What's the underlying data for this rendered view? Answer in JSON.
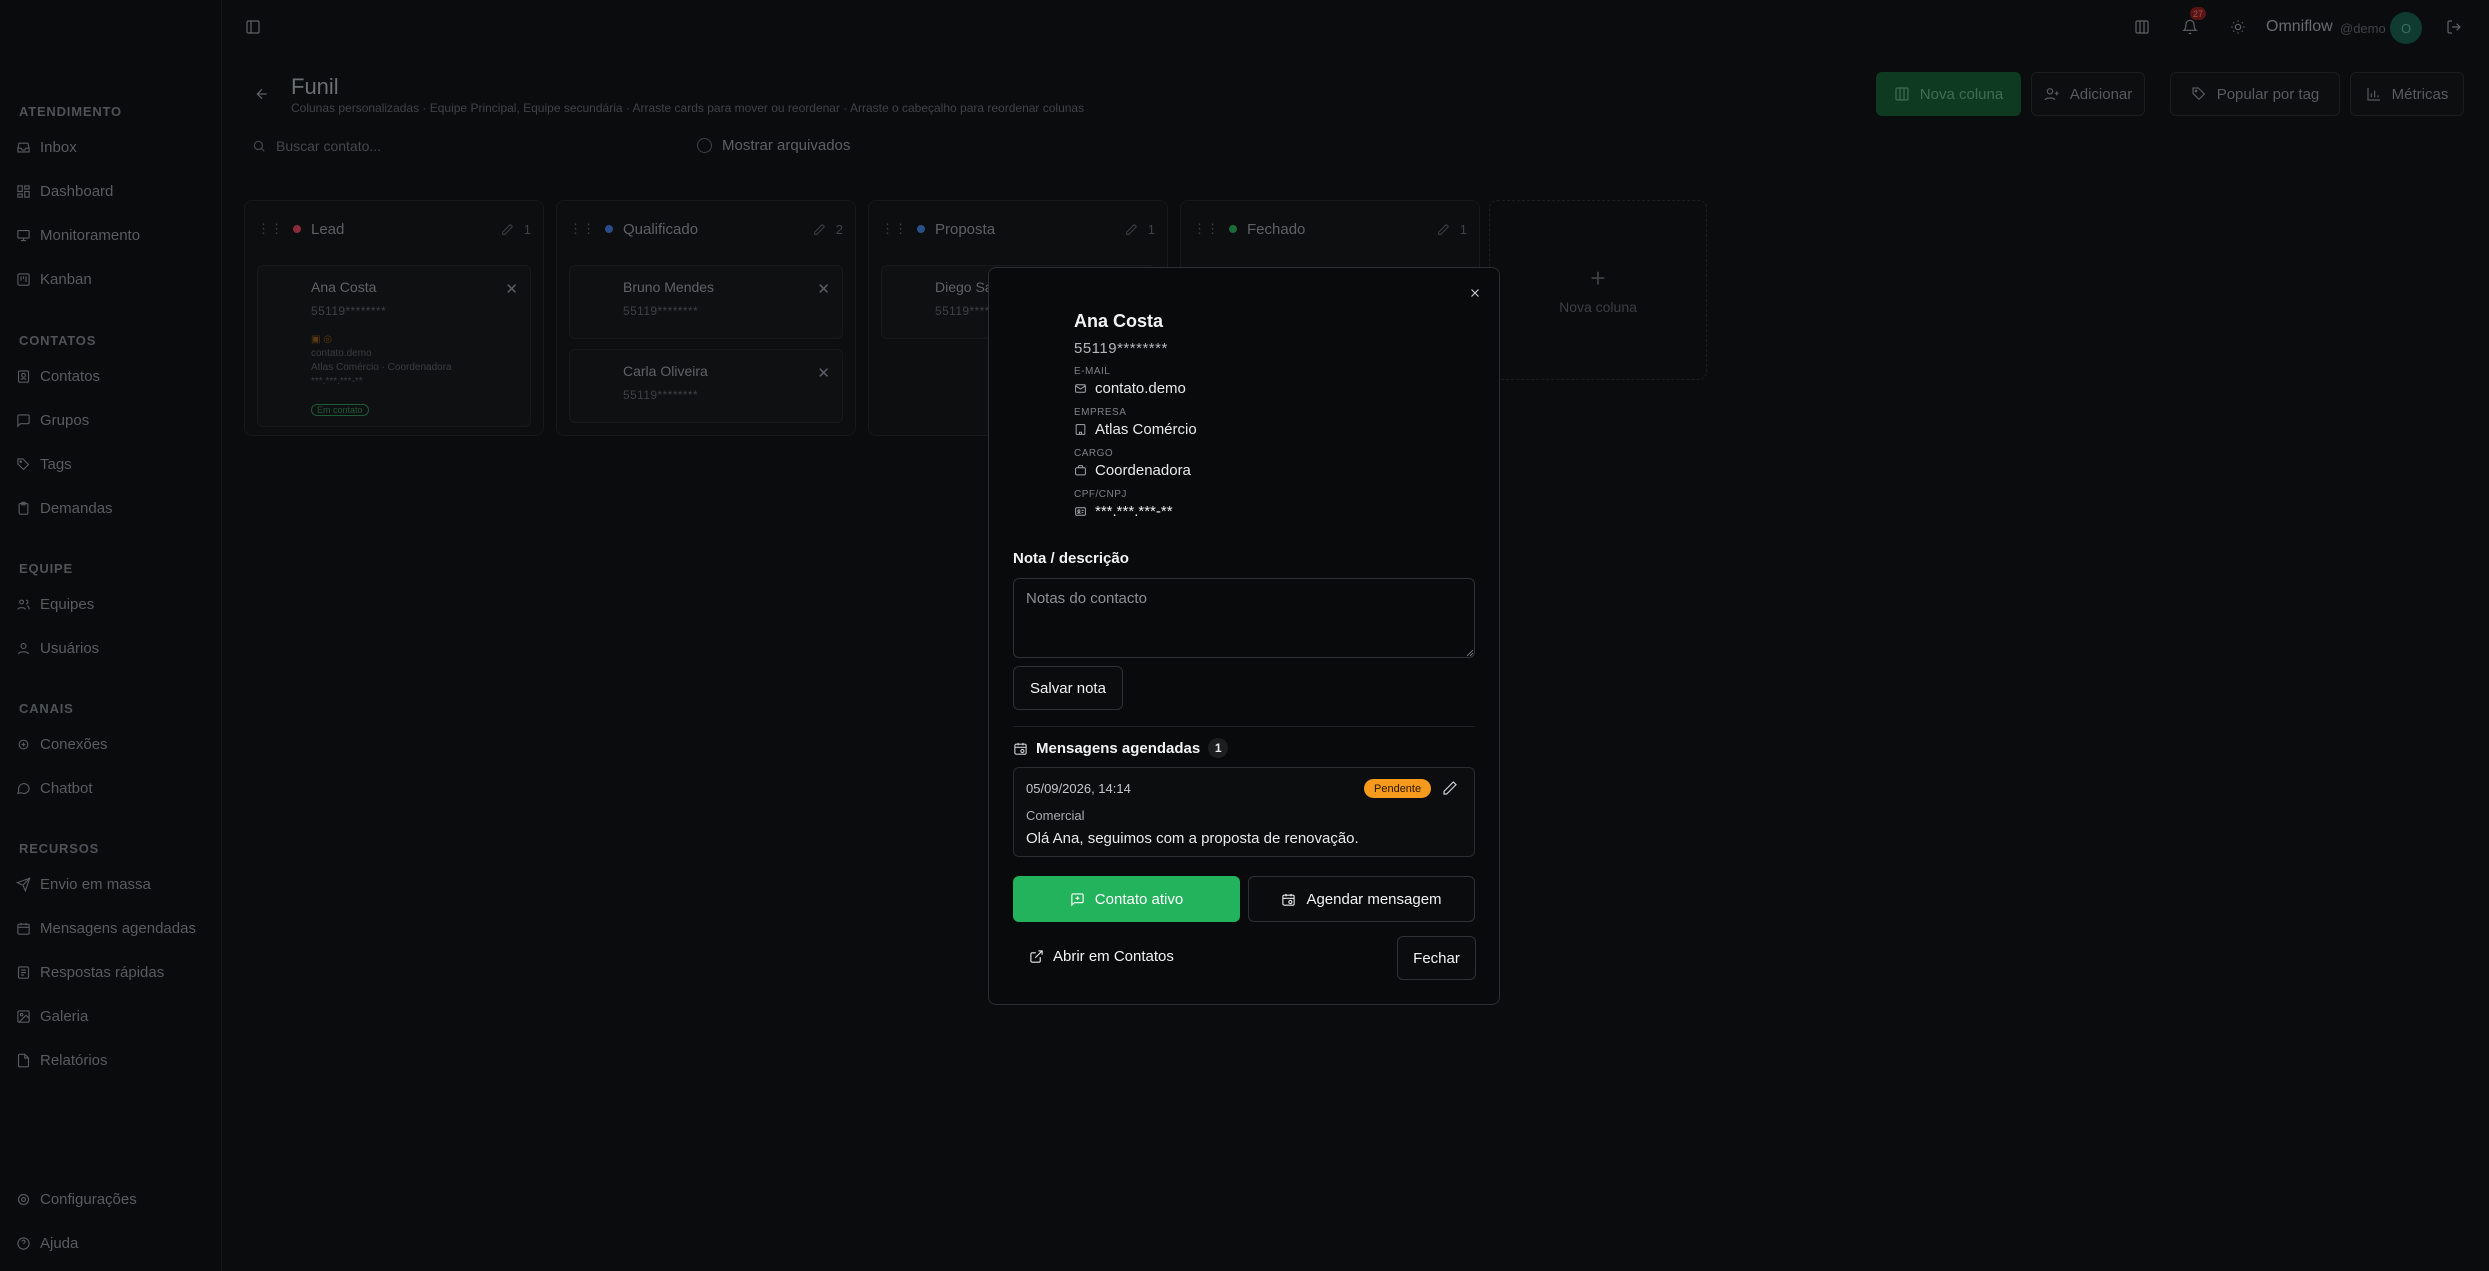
{
  "sidebar": {
    "sections": [
      {
        "title": "ATENDIMENTO",
        "items": [
          {
            "label": "Inbox",
            "icon": "inbox-icon"
          },
          {
            "label": "Dashboard",
            "icon": "dashboard-icon"
          },
          {
            "label": "Monitoramento",
            "icon": "monitor-icon"
          },
          {
            "label": "Kanban",
            "icon": "kanban-icon"
          }
        ]
      },
      {
        "title": "CONTATOS",
        "items": [
          {
            "label": "Contatos",
            "icon": "contacts-icon"
          },
          {
            "label": "Grupos",
            "icon": "groups-icon"
          },
          {
            "label": "Tags",
            "icon": "tag-icon"
          },
          {
            "label": "Demandas",
            "icon": "clipboard-icon"
          }
        ]
      },
      {
        "title": "EQUIPE",
        "items": [
          {
            "label": "Equipes",
            "icon": "team-icon"
          },
          {
            "label": "Usuários",
            "icon": "user-icon"
          }
        ]
      },
      {
        "title": "CANAIS",
        "items": [
          {
            "label": "Conexões",
            "icon": "plug-icon"
          },
          {
            "label": "Chatbot",
            "icon": "bot-icon"
          }
        ]
      },
      {
        "title": "RECURSOS",
        "items": [
          {
            "label": "Envio em massa",
            "icon": "send-icon"
          },
          {
            "label": "Mensagens agendadas",
            "icon": "calendar-clock-icon"
          },
          {
            "label": "Respostas rápidas",
            "icon": "lightning-icon"
          },
          {
            "label": "Galeria",
            "icon": "image-icon"
          },
          {
            "label": "Relatórios",
            "icon": "report-icon"
          }
        ]
      }
    ],
    "footer": [
      {
        "label": "Configurações",
        "icon": "gear-icon"
      },
      {
        "label": "Ajuda",
        "icon": "help-icon"
      }
    ]
  },
  "topbar": {
    "notification_count": "27",
    "brand": "Omniflow",
    "user_handle": "@demo",
    "avatar_initial": "O"
  },
  "page": {
    "title": "Funil",
    "subtitle": "Colunas personalizadas · Equipe Principal, Equipe secundária · Arraste cards para mover ou reordenar · Arraste o cabeçalho para reordenar colunas",
    "actions": {
      "new_column": "Nova coluna",
      "add": "Adicionar",
      "populate_by_tag": "Popular por tag",
      "metrics": "Métricas"
    },
    "search_placeholder": "Buscar contato...",
    "show_archived": "Mostrar arquivados"
  },
  "columns": [
    {
      "name": "Lead",
      "color": "#d9455f",
      "count": "1",
      "cards": [
        {
          "name": "Ana Costa",
          "phone": "55119********",
          "email": "contato.demo",
          "company_role": "Atlas Comércio · Coordenadora",
          "doc": "***.***.***-**",
          "tag": "Em contato"
        }
      ]
    },
    {
      "name": "Qualificado",
      "color": "#3b6fd8",
      "count": "2",
      "cards": [
        {
          "name": "Bruno Mendes",
          "phone": "55119********"
        },
        {
          "name": "Carla Oliveira",
          "phone": "55119********"
        }
      ]
    },
    {
      "name": "Proposta",
      "color": "#3b7fd8",
      "count": "1",
      "cards": [
        {
          "name": "Diego Sa",
          "phone": "55119********"
        }
      ]
    },
    {
      "name": "Fechado",
      "color": "#22b35c",
      "count": "1",
      "cards": []
    }
  ],
  "new_column_placeholder": "Nova coluna",
  "modal": {
    "name": "Ana Costa",
    "phone": "55119********",
    "fields": {
      "email": {
        "label": "E-MAIL",
        "value": "contato.demo"
      },
      "company": {
        "label": "EMPRESA",
        "value": "Atlas Comércio"
      },
      "role": {
        "label": "CARGO",
        "value": "Coordenadora"
      },
      "doc": {
        "label": "CPF/CNPJ",
        "value": "***.***.***-**"
      }
    },
    "note_label": "Nota / descrição",
    "note_placeholder": "Notas do contacto",
    "note_value": "",
    "save_note": "Salvar nota",
    "scheduled_title": "Mensagens agendadas",
    "scheduled_count": "1",
    "scheduled": {
      "datetime": "05/09/2026, 14:14",
      "status": "Pendente",
      "team": "Comercial",
      "message": "Olá Ana, seguimos com a proposta de renovação."
    },
    "active_contact": "Contato ativo",
    "schedule_message": "Agendar mensagem",
    "open_in_contacts": "Abrir em Contatos",
    "close": "Fechar"
  },
  "colors": {
    "accent_green": "#22b35c",
    "pending_orange": "#f59a1c",
    "background": "#0b0c0d"
  }
}
